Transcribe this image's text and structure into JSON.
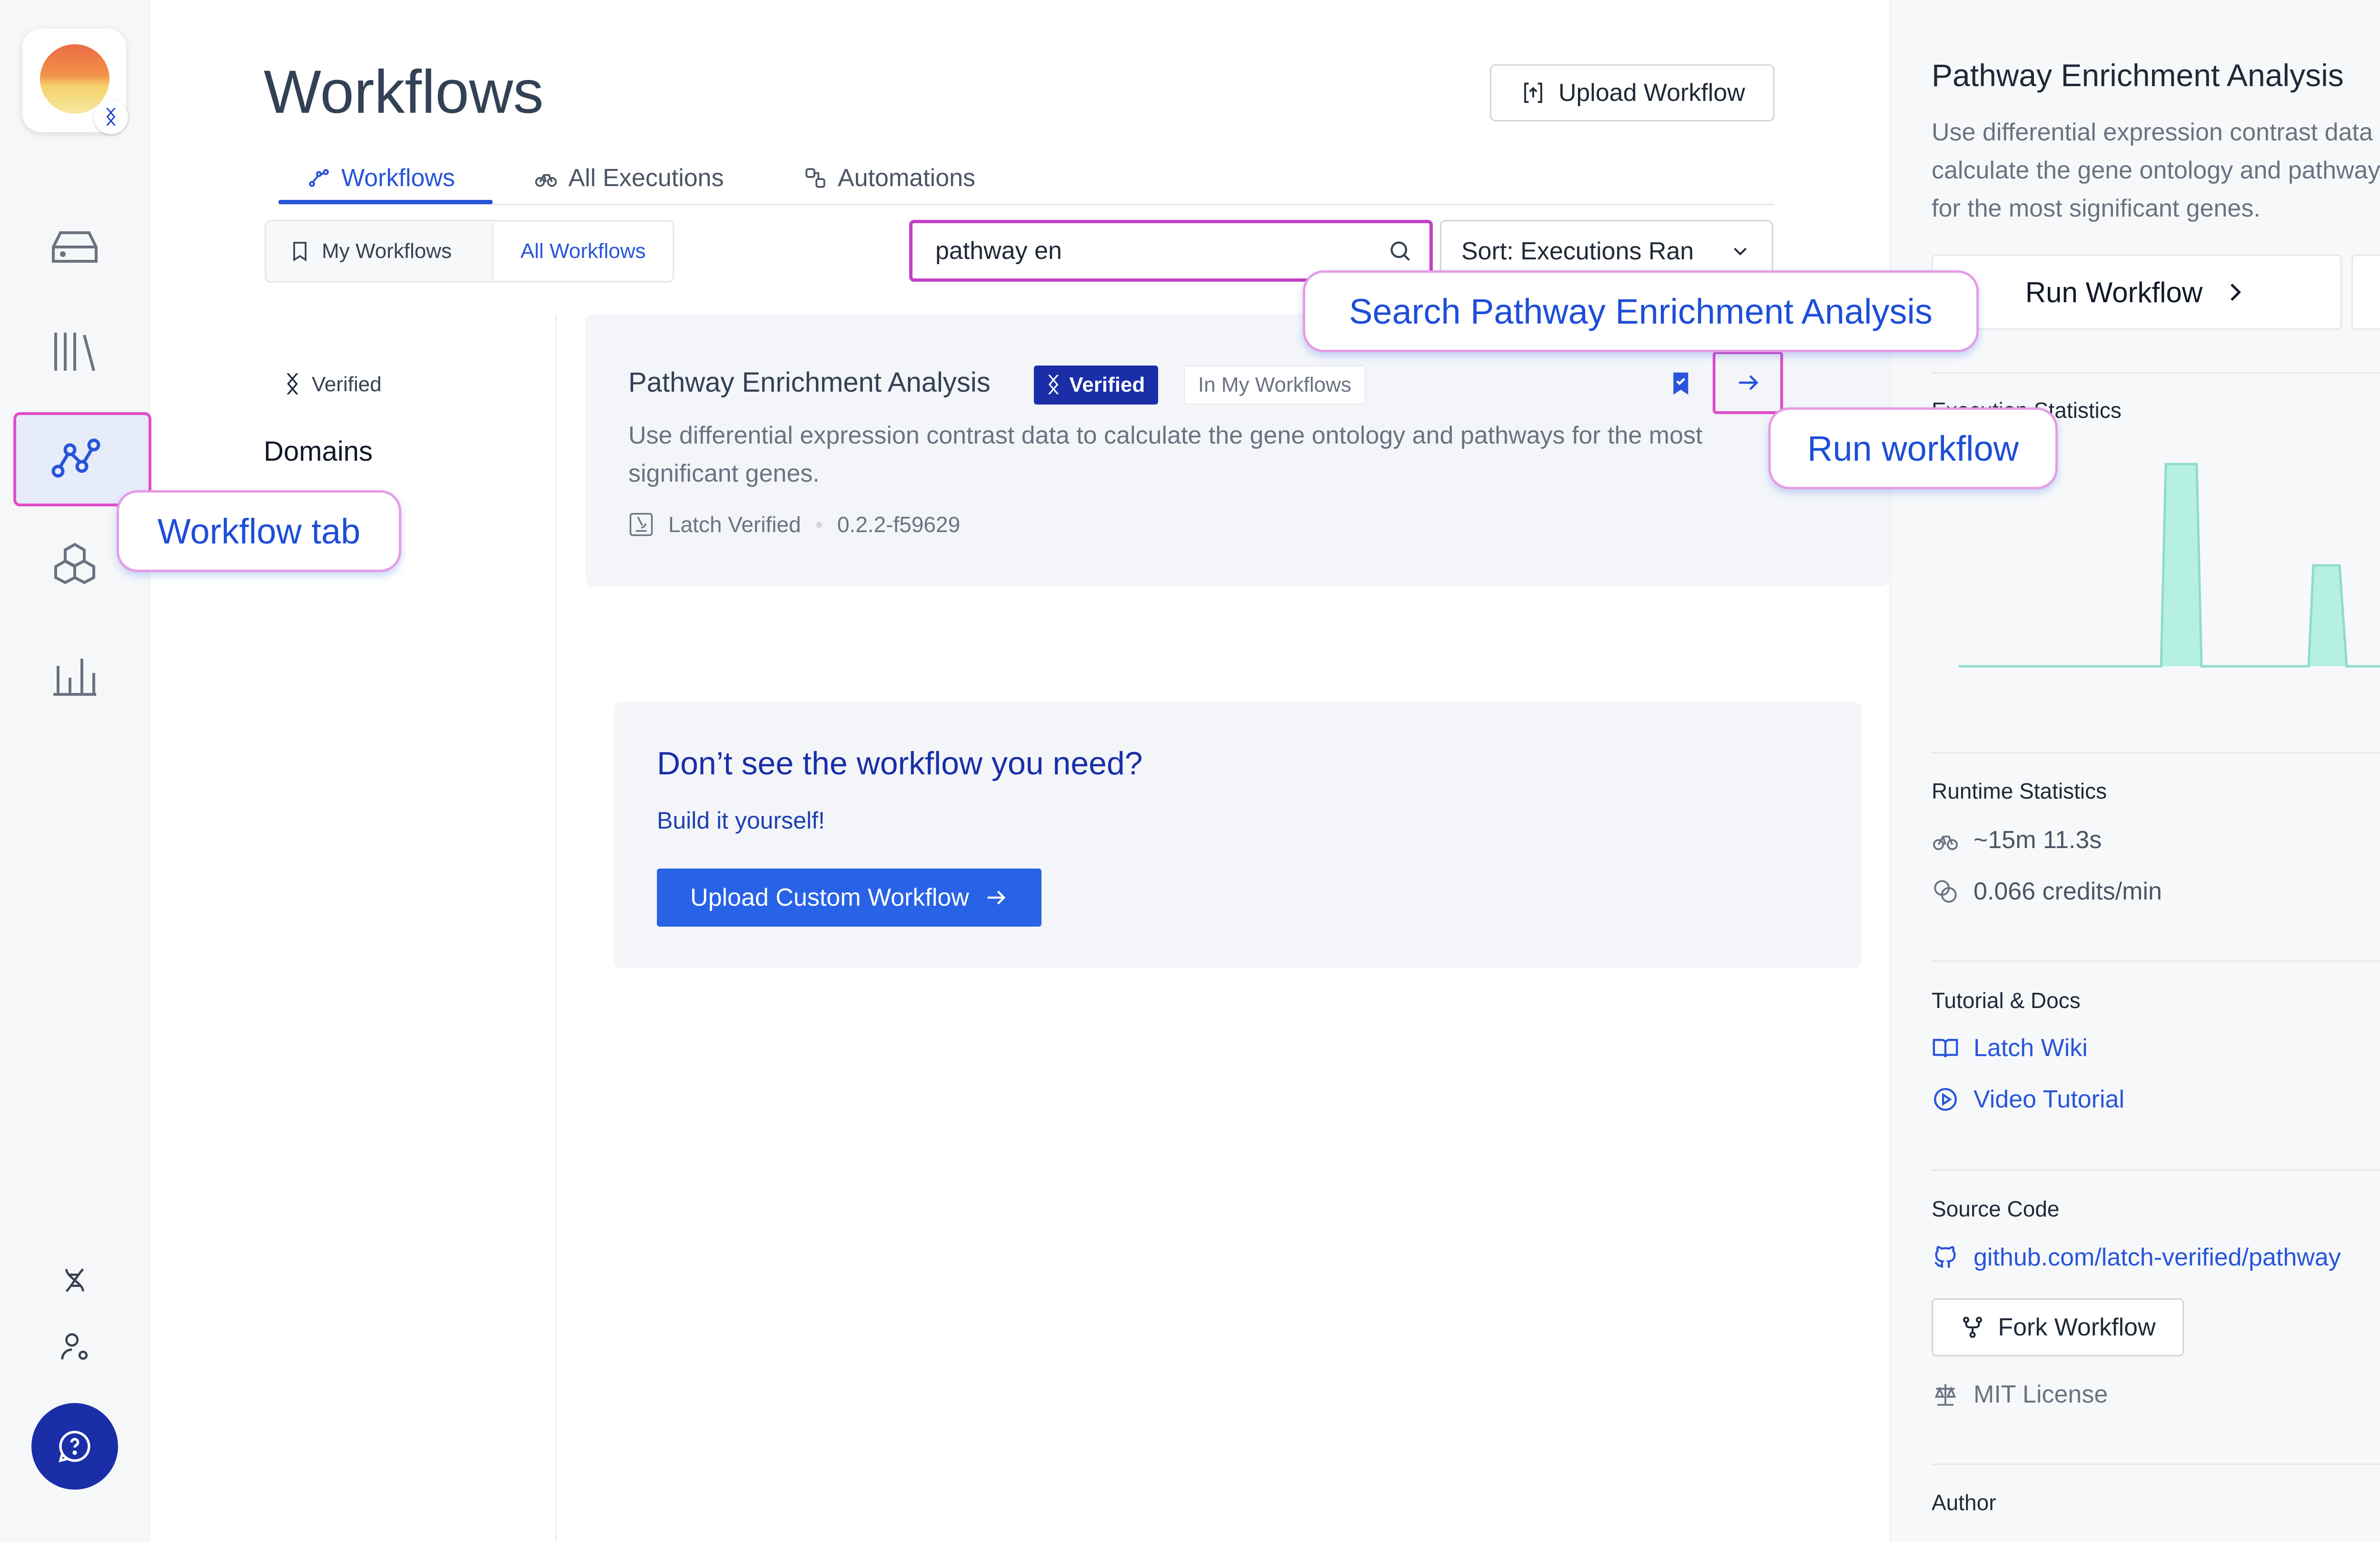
{
  "page": {
    "title": "Workflows"
  },
  "header": {
    "upload_label": "Upload Workflow"
  },
  "tabs": [
    {
      "label": "Workflows",
      "icon": "workflow-icon",
      "active": true
    },
    {
      "label": "All Executions",
      "icon": "bike-icon",
      "active": false
    },
    {
      "label": "Automations",
      "icon": "automation-icon",
      "active": false
    }
  ],
  "segment": {
    "my": "My Workflows",
    "all": "All Workflows"
  },
  "search": {
    "value": "pathway en"
  },
  "sort": {
    "label": "Sort: Executions Ran"
  },
  "filters": {
    "verified": "Verified",
    "domains": "Domains"
  },
  "card": {
    "title": "Pathway Enrichment Analysis",
    "verified_badge": "Verified",
    "in_my_badge": "In My Workflows",
    "description": "Use differential expression contrast data to calculate the gene ontology and pathways for the most significant genes.",
    "publisher": "Latch Verified",
    "version": "0.2.2-f59629"
  },
  "cta": {
    "heading": "Don’t see the workflow you need?",
    "sub": "Build it yourself!",
    "button": "Upload Custom Workflow"
  },
  "panel": {
    "title": "Pathway Enrichment Analysis",
    "description": "Use differential expression contrast data to calculate the gene ontology and pathways for the most significant genes.",
    "run_label": "Run Workflow",
    "exec_stats_label": "Execution Statistics",
    "runtime_label": "Runtime Statistics",
    "runtime_value": "~15m 11.3s",
    "credits_value": "0.066 credits/min",
    "docs_label": "Tutorial & Docs",
    "wiki_link": "Latch Wiki",
    "video_link": "Video Tutorial",
    "source_label": "Source Code",
    "source_link": "github.com/latch-verified/pathway",
    "fork_label": "Fork Workflow",
    "license": "MIT License",
    "author_label": "Author"
  },
  "callouts": {
    "workflow_tab": "Workflow tab",
    "search": "Search Pathway Enrichment Analysis",
    "run": "Run workflow"
  },
  "colors": {
    "accent": "#2855d9",
    "highlight": "#e14ec8",
    "verified": "#1a2ea8",
    "chart": "#9ce9d8"
  }
}
